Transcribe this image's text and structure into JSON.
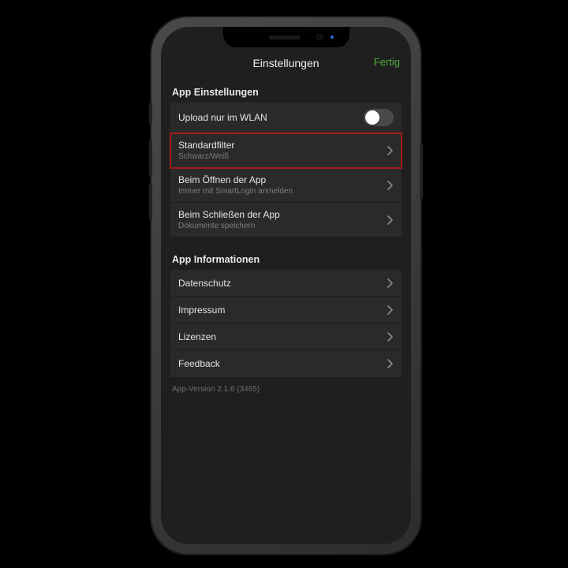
{
  "nav": {
    "title": "Einstellungen",
    "done": "Fertig"
  },
  "sections": {
    "appSettings": {
      "header": "App Einstellungen",
      "rows": {
        "uploadWlan": {
          "label": "Upload nur im WLAN"
        },
        "standardFilter": {
          "label": "Standardfilter",
          "sub": "Schwarz/Weiß"
        },
        "onOpen": {
          "label": "Beim Öffnen der App",
          "sub": "Immer mit SmartLogin anmelden"
        },
        "onClose": {
          "label": "Beim Schließen der App",
          "sub": "Dokumente speichern"
        }
      }
    },
    "appInfo": {
      "header": "App Informationen",
      "rows": {
        "privacy": {
          "label": "Datenschutz"
        },
        "imprint": {
          "label": "Impressum"
        },
        "licenses": {
          "label": "Lizenzen"
        },
        "feedback": {
          "label": "Feedback"
        }
      }
    }
  },
  "footer": {
    "version": "App-Version 2.1.6 (3465)"
  }
}
